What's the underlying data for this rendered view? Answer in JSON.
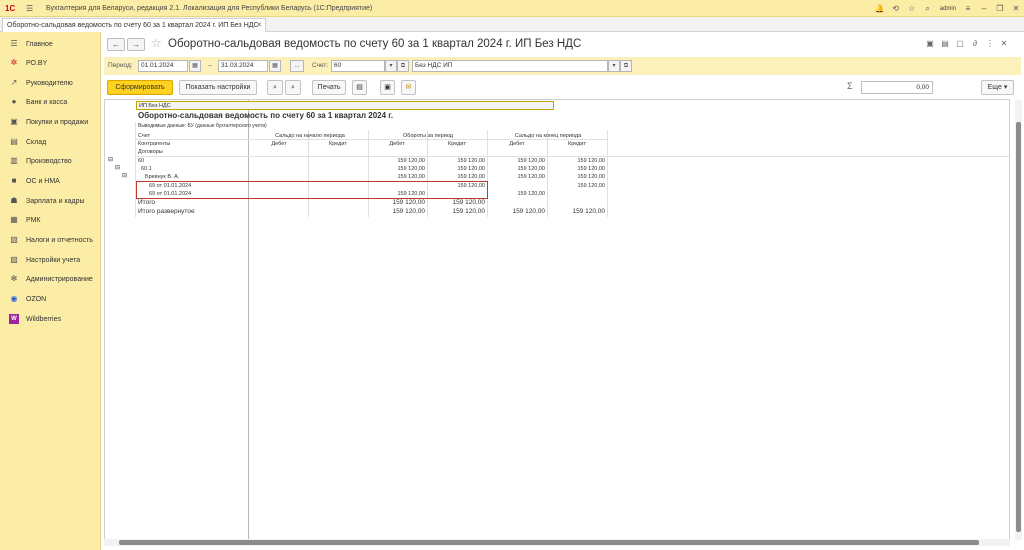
{
  "titlebar": {
    "app_title": "Бухгалтерия для Беларуси, редакция 2.1. Локализация для Республики Беларусь  (1С:Предприятие)",
    "user": "admin",
    "logo_text": "1C"
  },
  "tab": {
    "label": "Оборотно-сальдовая ведомость по счету 60 за 1 квартал 2024 г. ИП Без НДС"
  },
  "sidebar": {
    "items": [
      {
        "label": "Главное",
        "icon": "menu-icon"
      },
      {
        "label": "РО.BY",
        "icon": "gear-icon"
      },
      {
        "label": "Руководителю",
        "icon": "chart-icon"
      },
      {
        "label": "Банк и касса",
        "icon": "bank-icon"
      },
      {
        "label": "Покупки и продажи",
        "icon": "cart-icon"
      },
      {
        "label": "Склад",
        "icon": "warehouse-icon"
      },
      {
        "label": "Производство",
        "icon": "factory-icon"
      },
      {
        "label": "ОС и НМА",
        "icon": "truck-icon"
      },
      {
        "label": "Зарплата и кадры",
        "icon": "people-icon"
      },
      {
        "label": "РМК",
        "icon": "register-icon"
      },
      {
        "label": "Налоги и отчетность",
        "icon": "report-icon"
      },
      {
        "label": "Настройки учета",
        "icon": "settings-doc-icon"
      },
      {
        "label": "Администрирование",
        "icon": "gear-icon"
      },
      {
        "label": "OZON",
        "icon": "ozon-icon"
      },
      {
        "label": "Wildberries",
        "icon": "wildberries-icon"
      }
    ]
  },
  "doc": {
    "title": "Оборотно-сальдовая ведомость по счету 60 за 1 квартал 2024 г. ИП Без НДС"
  },
  "params": {
    "period_label": "Период:",
    "date_from": "01.01.2024",
    "dash": "–",
    "date_to": "31.03.2024",
    "ellipsis": "...",
    "account_label": "Счет:",
    "account": "60",
    "org": "Без НДС ИП"
  },
  "toolbar": {
    "generate": "Сформировать",
    "show_settings": "Показать настройки",
    "print": "Печать",
    "sum_value": "0,00",
    "more": "Еще ▾"
  },
  "report": {
    "org": "ИП Без НДС",
    "title": "Оборотно-сальдовая ведомость по счету 60 за 1 квартал 2024 г.",
    "output": "Выводимые данные:  БУ (данные бухгалтерского учета)",
    "h_account": "Счет",
    "h_counterparties": "Контрагенты",
    "h_contracts": "Договоры",
    "h_open": "Сальдо на начало периода",
    "h_turnover": "Обороты за период",
    "h_close": "Сальдо на конец периода",
    "debit": "Дебет",
    "credit": "Кредит",
    "rows": [
      {
        "name": "60",
        "tdeb": "159 120,00",
        "tcred": "159 120,00",
        "cdeb": "159 120,00",
        "ccred": "159 120,00"
      },
      {
        "name": "60.1",
        "tdeb": "159 120,00",
        "tcred": "159 120,00",
        "cdeb": "159 120,00",
        "ccred": "159 120,00"
      },
      {
        "name": "Бревнук В. А.",
        "tdeb": "159 120,00",
        "tcred": "159 120,00",
        "cdeb": "159 120,00",
        "ccred": "159 120,00"
      },
      {
        "name": "69 от 01.01.2024",
        "tdeb": "",
        "tcred": "159 120,00",
        "cdeb": "",
        "ccred": "159 120,00"
      },
      {
        "name": "69 от 01.01.2024",
        "tdeb": "159 120,00",
        "tcred": "",
        "cdeb": "159 120,00",
        "ccred": ""
      }
    ],
    "total_label": "Итого",
    "total_tdeb": "159 120,00",
    "total_tcred": "159 120,00",
    "exp_label": "Итого развернутое",
    "exp_tdeb": "159 120,00",
    "exp_tcred": "159 120,00",
    "exp_cdeb": "159 120,00",
    "exp_ccred": "159 120,00"
  },
  "colors": {
    "accent": "#ffd21f",
    "panel": "#fbeca6",
    "highlight": "#c0392b"
  }
}
